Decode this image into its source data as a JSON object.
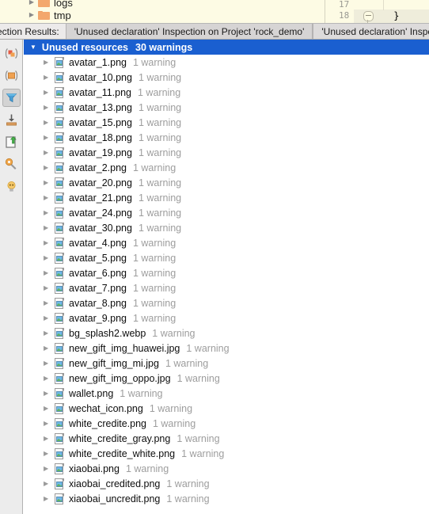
{
  "project_tree": {
    "rows": [
      {
        "label": "logs",
        "icon": "folder-icon",
        "arrow": "▶"
      },
      {
        "label": "tmp",
        "icon": "folder-icon",
        "arrow": "▶"
      }
    ]
  },
  "editor": {
    "line_numbers": [
      "17",
      "18"
    ],
    "code": "}"
  },
  "tabbar": {
    "label": "ection Results:",
    "tabs": [
      {
        "label": "'Unused declaration' Inspection on Project 'rock_demo'",
        "active": true
      },
      {
        "label": "'Unused declaration' Inspection",
        "active": false
      }
    ]
  },
  "toolbar": {
    "buttons": [
      {
        "name": "group-by-icon",
        "tooltip": "Group by",
        "pressed": false
      },
      {
        "name": "collapse-all-icon",
        "tooltip": "Collapse All",
        "pressed": false
      },
      {
        "name": "filter-icon",
        "tooltip": "Filter Inspections",
        "pressed": true
      },
      {
        "name": "export-icon",
        "tooltip": "Export",
        "pressed": false
      },
      {
        "name": "open-in-editor-icon",
        "tooltip": "Open in Editor",
        "pressed": false
      },
      {
        "name": "settings-wrench-icon",
        "tooltip": "Edit Settings",
        "pressed": false
      },
      {
        "name": "lightbulb-icon",
        "tooltip": "Quick Fix",
        "pressed": false
      }
    ]
  },
  "results": {
    "group": {
      "arrow": "▼",
      "title": "Unused resources",
      "count": "30 warnings"
    },
    "row_arrow": "▶",
    "items": [
      {
        "file": "avatar_1.png",
        "warning": "1 warning"
      },
      {
        "file": "avatar_10.png",
        "warning": "1 warning"
      },
      {
        "file": "avatar_11.png",
        "warning": "1 warning"
      },
      {
        "file": "avatar_13.png",
        "warning": "1 warning"
      },
      {
        "file": "avatar_15.png",
        "warning": "1 warning"
      },
      {
        "file": "avatar_18.png",
        "warning": "1 warning"
      },
      {
        "file": "avatar_19.png",
        "warning": "1 warning"
      },
      {
        "file": "avatar_2.png",
        "warning": "1 warning"
      },
      {
        "file": "avatar_20.png",
        "warning": "1 warning"
      },
      {
        "file": "avatar_21.png",
        "warning": "1 warning"
      },
      {
        "file": "avatar_24.png",
        "warning": "1 warning"
      },
      {
        "file": "avatar_30.png",
        "warning": "1 warning"
      },
      {
        "file": "avatar_4.png",
        "warning": "1 warning"
      },
      {
        "file": "avatar_5.png",
        "warning": "1 warning"
      },
      {
        "file": "avatar_6.png",
        "warning": "1 warning"
      },
      {
        "file": "avatar_7.png",
        "warning": "1 warning"
      },
      {
        "file": "avatar_8.png",
        "warning": "1 warning"
      },
      {
        "file": "avatar_9.png",
        "warning": "1 warning"
      },
      {
        "file": "bg_splash2.webp",
        "warning": "1 warning"
      },
      {
        "file": "new_gift_img_huawei.jpg",
        "warning": "1 warning"
      },
      {
        "file": "new_gift_img_mi.jpg",
        "warning": "1 warning"
      },
      {
        "file": "new_gift_img_oppo.jpg",
        "warning": "1 warning"
      },
      {
        "file": "wallet.png",
        "warning": "1 warning"
      },
      {
        "file": "wechat_icon.png",
        "warning": "1 warning"
      },
      {
        "file": "white_credite.png",
        "warning": "1 warning"
      },
      {
        "file": "white_credite_gray.png",
        "warning": "1 warning"
      },
      {
        "file": "white_credite_white.png",
        "warning": "1 warning"
      },
      {
        "file": "xiaobai.png",
        "warning": "1 warning"
      },
      {
        "file": "xiaobai_credited.png",
        "warning": "1 warning"
      },
      {
        "file": "xiaobai_uncredit.png",
        "warning": "1 warning"
      }
    ]
  },
  "colors": {
    "selection_blue": "#1a5fd0",
    "editor_bg": "#fdfbe4",
    "toolbar_bg": "#ececec",
    "tab_active": "#d6d4d4",
    "warning_text": "#9d9d9d"
  }
}
